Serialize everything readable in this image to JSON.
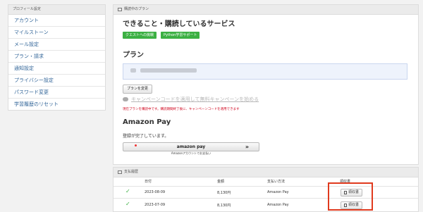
{
  "sidebar": {
    "header": "プロフィール設定",
    "items": [
      {
        "label": "アカウント"
      },
      {
        "label": "マイルストーン"
      },
      {
        "label": "メール設定"
      },
      {
        "label": "プラン・請求"
      },
      {
        "label": "通知設定"
      },
      {
        "label": "プライバシー設定"
      },
      {
        "label": "パスワード変更"
      },
      {
        "label": "学習履歴のリセット"
      }
    ]
  },
  "plan_panel": {
    "header": "購読中のプラン",
    "services_title": "できること・購読しているサービス",
    "tags": [
      "クエストへの挑戦",
      "Python学習サポート"
    ],
    "plan_title": "プラン",
    "change_button": "プランを変更",
    "campaign_link": "キャンペーンコードを適用して無料キャンペーンを始める",
    "warning": "現在プランを購読中です。購読期間終了後に、キャンペーンコードを適用できます",
    "amazon_title": "Amazon Pay",
    "amazon_status": "登録が完了しています。",
    "amazon_logo": "amazon pay",
    "amazon_chevron": "»",
    "amazon_sub": "Amazonアカウントでお支払い"
  },
  "payment_panel": {
    "header": "支払履歴",
    "columns": [
      "日付",
      "金額",
      "支払い方法",
      "領収書"
    ],
    "rows": [
      {
        "status": "✓",
        "date": "2023-08-09",
        "amount": "8,130円",
        "method": "Amazon Pay",
        "receipt": "領収書"
      },
      {
        "status": "✓",
        "date": "2023-07-09",
        "amount": "8,130円",
        "method": "Amazon Pay",
        "receipt": "領収書"
      }
    ]
  },
  "colors": {
    "accent_green": "#3cb043",
    "warning_red": "#d0021b",
    "highlight": "#e03a1e",
    "link_blue": "#336699"
  }
}
